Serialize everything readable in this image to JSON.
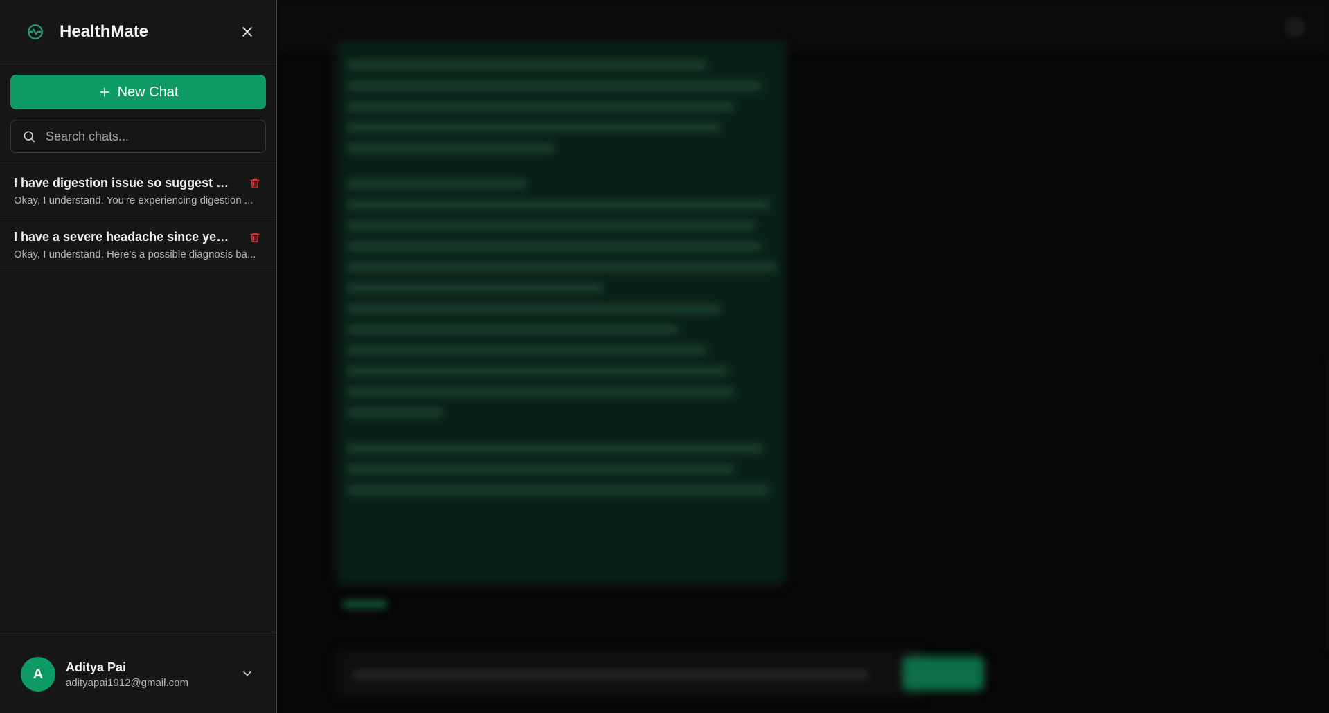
{
  "app": {
    "title": "HealthMate",
    "logo_icon": "heart-pulse-icon",
    "close_icon": "close-icon"
  },
  "sidebar": {
    "new_chat_label": "New Chat",
    "search_placeholder": "Search chats...",
    "chats": [
      {
        "title": "I have digestion issue so suggest me d...",
        "preview": "Okay, I understand. You're experiencing digestion ..."
      },
      {
        "title": "I have a severe headache since yesterd...",
        "preview": "Okay, I understand. Here's a possible diagnosis ba..."
      }
    ]
  },
  "user": {
    "initial": "A",
    "name": "Aditya Pai",
    "email": "adityapai1912@gmail.com"
  },
  "colors": {
    "accent": "#0e9a63",
    "sidebar_bg": "#161616",
    "delete": "#e53935"
  }
}
